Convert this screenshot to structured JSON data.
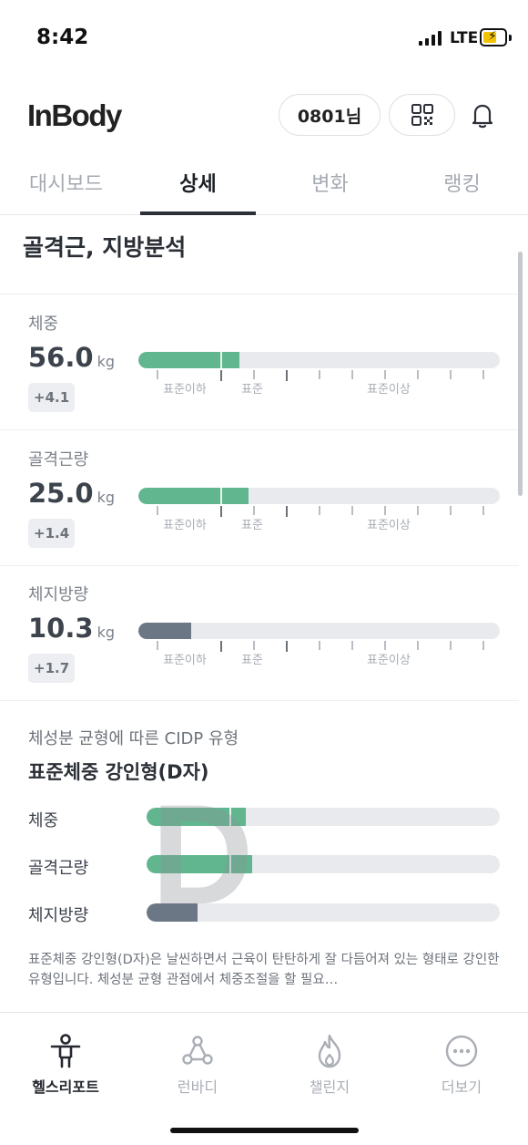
{
  "status_bar": {
    "time": "8:42",
    "network": "LTE"
  },
  "header": {
    "logo": "InBody",
    "user": "0801님"
  },
  "tabs": [
    {
      "label": "대시보드",
      "active": false
    },
    {
      "label": "상세",
      "active": true
    },
    {
      "label": "변화",
      "active": false
    },
    {
      "label": "랭킹",
      "active": false
    }
  ],
  "section": {
    "title": "골격근, 지방분석"
  },
  "range_labels": {
    "low": "표준이하",
    "normal": "표준",
    "high": "표준이상"
  },
  "metrics": [
    {
      "label": "체중",
      "value": "56.0",
      "unit": "kg",
      "delta": "+4.1",
      "level": 0.28,
      "color": "#61b68f"
    },
    {
      "label": "골격근량",
      "value": "25.0",
      "unit": "kg",
      "delta": "+1.4",
      "level": 0.305,
      "color": "#61b68f"
    },
    {
      "label": "체지방량",
      "value": "10.3",
      "unit": "kg",
      "delta": "+1.7",
      "level": 0.145,
      "color": "#6c7785"
    }
  ],
  "cidp": {
    "caption": "체성분 균형에 따른 CIDP 유형",
    "type": "표준체중 강인형(D자)",
    "letter": "D",
    "rows": [
      {
        "label": "체중",
        "level": 0.28,
        "color": "#61b68f"
      },
      {
        "label": "골격근량",
        "level": 0.3,
        "color": "#61b68f"
      },
      {
        "label": "체지방량",
        "level": 0.145,
        "color": "#6c7785"
      }
    ],
    "description": "표준체중 강인형(D자)은 날씬하면서 근육이 탄탄하게 잘 다듬어져 있는 형태로 강인한 유형입니다. 체성분 균형 관점에서 체중조절을 할 필요…"
  },
  "bottom_nav": [
    {
      "label": "헬스리포트",
      "icon": "person-icon",
      "active": true
    },
    {
      "label": "런바디",
      "icon": "route-icon",
      "active": false
    },
    {
      "label": "챌린지",
      "icon": "flame-icon",
      "active": false
    },
    {
      "label": "더보기",
      "icon": "more-icon",
      "active": false
    }
  ]
}
